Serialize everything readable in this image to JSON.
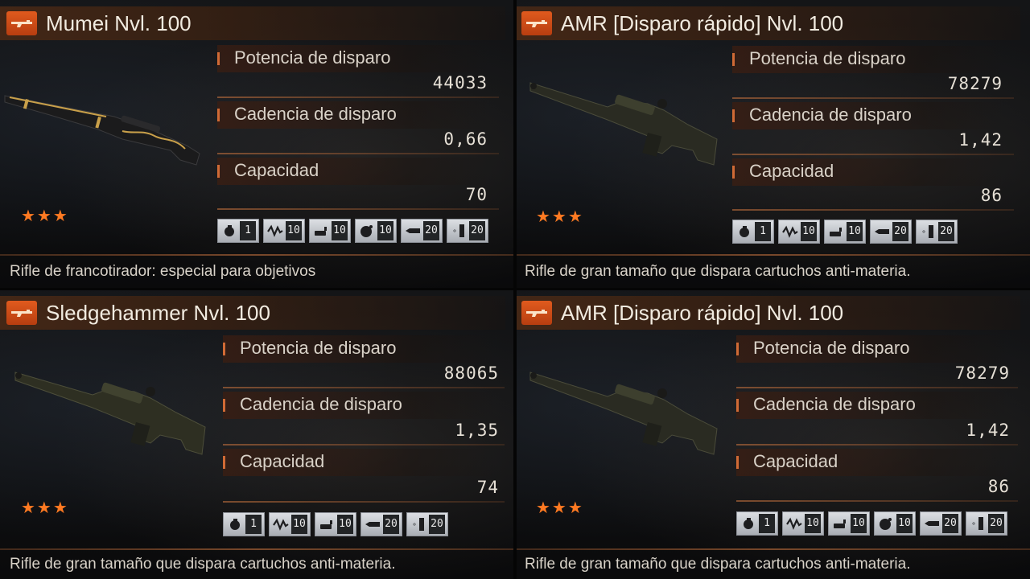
{
  "stat_labels": {
    "power": "Potencia de disparo",
    "rate": "Cadencia de disparo",
    "capacity": "Capacidad"
  },
  "rarity_stars": "★★★",
  "accent_color": "#e05a1e",
  "cards": [
    {
      "title": "Mumei Nvl. 100",
      "power": "44033",
      "rate": "0,66",
      "capacity": "70",
      "description": "Rifle de francotirador: especial para objetivos",
      "upgrades": [
        {
          "icon": "grenade-icon",
          "level": "1"
        },
        {
          "icon": "wave-icon",
          "level": "10"
        },
        {
          "icon": "bullet-icon",
          "level": "10"
        },
        {
          "icon": "bomb-icon",
          "level": "10"
        },
        {
          "icon": "shell-icon",
          "level": "20"
        },
        {
          "icon": "magazine-icon",
          "level": "20"
        }
      ]
    },
    {
      "title": "AMR [Disparo rápido] Nvl. 100",
      "power": "78279",
      "rate": "1,42",
      "capacity": "86",
      "description": "Rifle de gran tamaño que dispara cartuchos anti-materia.",
      "upgrades": [
        {
          "icon": "grenade-icon",
          "level": "1"
        },
        {
          "icon": "wave-icon",
          "level": "10"
        },
        {
          "icon": "bullet-icon",
          "level": "10"
        },
        {
          "icon": "shell-icon",
          "level": "20"
        },
        {
          "icon": "magazine-icon",
          "level": "20"
        }
      ]
    },
    {
      "title": "Sledgehammer Nvl. 100",
      "power": "88065",
      "rate": "1,35",
      "capacity": "74",
      "description": "Rifle de gran tamaño que dispara cartuchos anti-materia.",
      "upgrades": [
        {
          "icon": "grenade-icon",
          "level": "1"
        },
        {
          "icon": "wave-icon",
          "level": "10"
        },
        {
          "icon": "bullet-icon",
          "level": "10"
        },
        {
          "icon": "shell-icon",
          "level": "20"
        },
        {
          "icon": "magazine-icon",
          "level": "20"
        }
      ]
    },
    {
      "title": "AMR [Disparo rápido] Nvl. 100",
      "power": "78279",
      "rate": "1,42",
      "capacity": "86",
      "description": "Rifle de gran tamaño que dispara cartuchos anti-materia.",
      "upgrades": [
        {
          "icon": "grenade-icon",
          "level": "1"
        },
        {
          "icon": "wave-icon",
          "level": "10"
        },
        {
          "icon": "bullet-icon",
          "level": "10"
        },
        {
          "icon": "bomb-icon",
          "level": "10"
        },
        {
          "icon": "shell-icon",
          "level": "20"
        },
        {
          "icon": "magazine-icon",
          "level": "20"
        }
      ]
    }
  ]
}
